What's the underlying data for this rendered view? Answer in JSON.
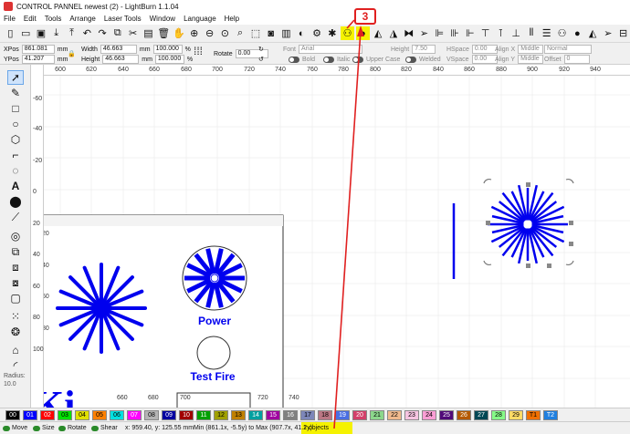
{
  "window": {
    "title": "CONTROL PANNEL newest (2) - LightBurn 1.1.04"
  },
  "menu": [
    "File",
    "Edit",
    "Tools",
    "Arrange",
    "Laser Tools",
    "Window",
    "Language",
    "Help"
  ],
  "props": {
    "xpos_label": "XPos",
    "xpos": "861.081",
    "ypos_label": "YPos",
    "ypos": "41.207",
    "unit": "mm",
    "width_label": "Width",
    "width": "46.663",
    "height_label": "Height",
    "height": "46.663",
    "scale_w": "100.000",
    "scale_h": "100.000",
    "pct": "%",
    "rotate_label": "Rotate",
    "rotate": "0.00"
  },
  "text_props": {
    "font_label": "Font",
    "font": "Arial",
    "height_label": "Height",
    "height": "7.50",
    "hspace_label": "HSpace",
    "hspace": "0.00",
    "vspace_label": "VSpace",
    "vspace": "0.00",
    "alignx_label": "Align X",
    "alignx": "Middle",
    "aligny_label": "Align Y",
    "aligny": "Middle",
    "normal": "Normal",
    "offset_label": "Offset",
    "offset": "0",
    "bold": "Bold",
    "italic": "Italic",
    "upper_case": "Upper Case",
    "welded": "Welded"
  },
  "ruler_top": [
    "600",
    "620",
    "640",
    "660",
    "680",
    "700",
    "720",
    "740",
    "760",
    "780",
    "800",
    "820",
    "840",
    "860",
    "880",
    "900",
    "920",
    "940"
  ],
  "ruler_left": [
    "-60",
    "-40",
    "-20",
    "0",
    "20",
    "40",
    "60",
    "80",
    "100"
  ],
  "ruler_inner": [
    "20",
    "40",
    "60",
    "80"
  ],
  "inner_ruler_bottom": [
    "660",
    "680",
    "700",
    "720",
    "740"
  ],
  "canvas": {
    "power_label": "Power",
    "test_fire_label": "Test Fire",
    "partial_text": "Ki"
  },
  "palette": [
    {
      "label": "00",
      "color": "#000000",
      "text": "#ffffff"
    },
    {
      "label": "01",
      "color": "#0000ff",
      "text": "#ffffff"
    },
    {
      "label": "02",
      "color": "#ff0000",
      "text": "#ffffff"
    },
    {
      "label": "03",
      "color": "#00e000",
      "text": "#000000"
    },
    {
      "label": "04",
      "color": "#e0e000",
      "text": "#000000"
    },
    {
      "label": "05",
      "color": "#ff8000",
      "text": "#000000"
    },
    {
      "label": "06",
      "color": "#00e0e0",
      "text": "#000000"
    },
    {
      "label": "07",
      "color": "#ff00ff",
      "text": "#ffffff"
    },
    {
      "label": "08",
      "color": "#b4b4b4",
      "text": "#000000"
    },
    {
      "label": "09",
      "color": "#0000a0",
      "text": "#ffffff"
    },
    {
      "label": "10",
      "color": "#a00000",
      "text": "#ffffff"
    },
    {
      "label": "11",
      "color": "#00a000",
      "text": "#ffffff"
    },
    {
      "label": "12",
      "color": "#a0a000",
      "text": "#000000"
    },
    {
      "label": "13",
      "color": "#c08000",
      "text": "#000000"
    },
    {
      "label": "14",
      "color": "#00a0a0",
      "text": "#ffffff"
    },
    {
      "label": "15",
      "color": "#a000a0",
      "text": "#ffffff"
    },
    {
      "label": "16",
      "color": "#808080",
      "text": "#ffffff"
    },
    {
      "label": "17",
      "color": "#7d87b9",
      "text": "#000000"
    },
    {
      "label": "18",
      "color": "#bb7784",
      "text": "#000000"
    },
    {
      "label": "19",
      "color": "#4a6fe3",
      "text": "#ffffff"
    },
    {
      "label": "20",
      "color": "#d33f6a",
      "text": "#ffffff"
    },
    {
      "label": "21",
      "color": "#8cd78c",
      "text": "#000000"
    },
    {
      "label": "22",
      "color": "#f0b98d",
      "text": "#000000"
    },
    {
      "label": "23",
      "color": "#f6c4e1",
      "text": "#000000"
    },
    {
      "label": "24",
      "color": "#fa9ed4",
      "text": "#000000"
    },
    {
      "label": "25",
      "color": "#500a78",
      "text": "#ffffff"
    },
    {
      "label": "26",
      "color": "#b45a00",
      "text": "#ffffff"
    },
    {
      "label": "27",
      "color": "#004754",
      "text": "#ffffff"
    },
    {
      "label": "28",
      "color": "#86fa88",
      "text": "#000000"
    },
    {
      "label": "29",
      "color": "#ffdb66",
      "text": "#000000"
    },
    {
      "label": "T1",
      "color": "#f07000",
      "text": "#000000"
    },
    {
      "label": "T2",
      "color": "#2080e0",
      "text": "#ffffff"
    }
  ],
  "status": {
    "move": "Move",
    "size": "Size",
    "rotate": "Rotate",
    "shear": "Shear",
    "coords": "x: 959.40, y: 125.55 mm",
    "minmax": "Min (861.1x, -5.5y) to Max (907.7x, 41.2y)",
    "objects": "1 objects"
  },
  "annotation": {
    "number": "3",
    "color": "#e02020"
  },
  "radius": {
    "label": "Radius:",
    "value": "10.0"
  },
  "colors": {
    "blue": "#0000ee",
    "highlight": "#f5f200"
  }
}
